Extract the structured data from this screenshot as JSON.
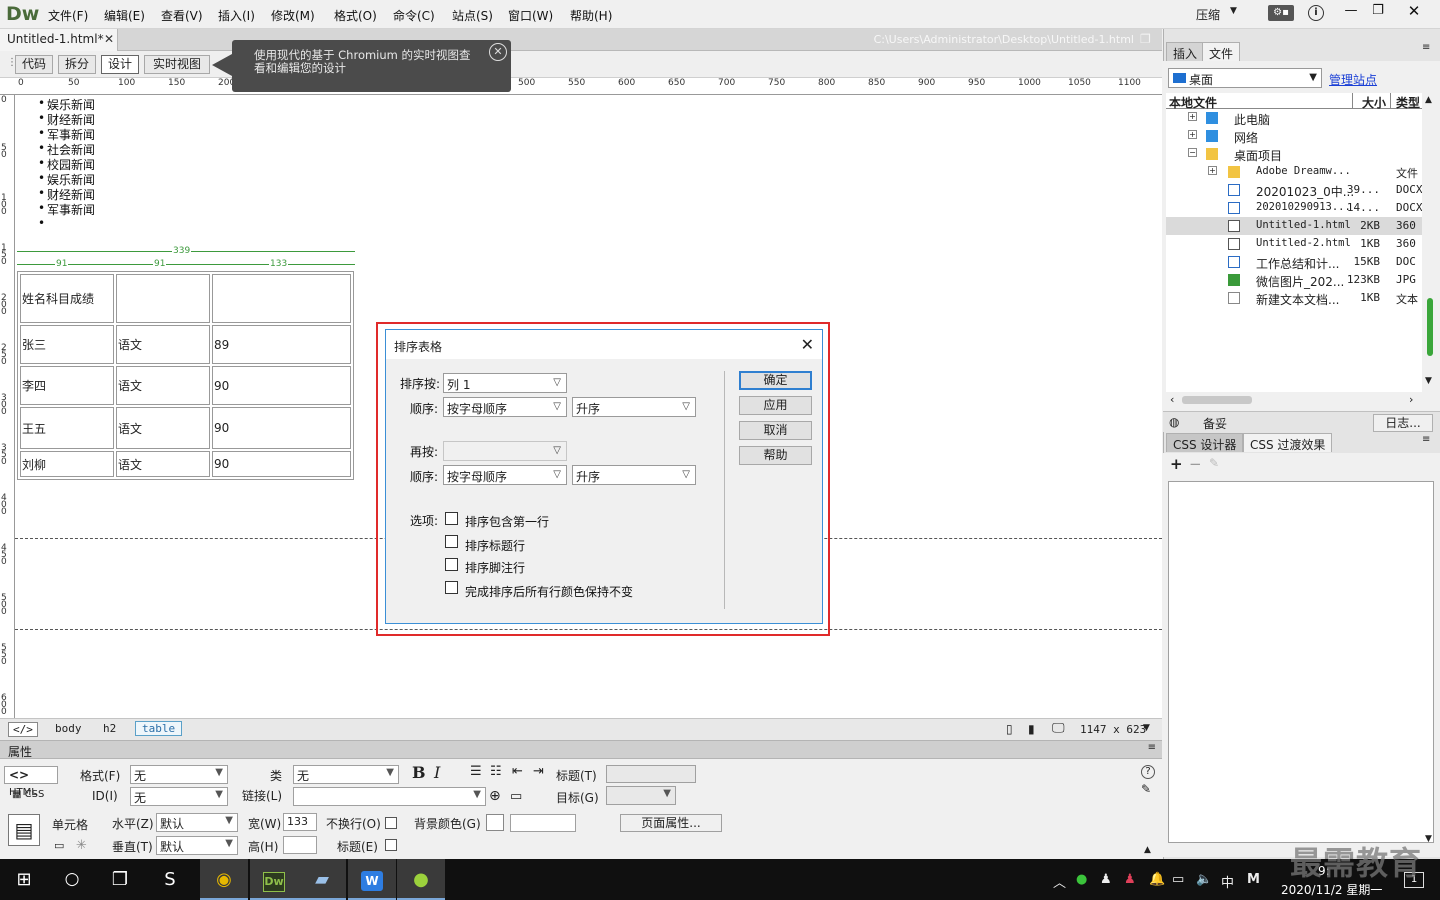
{
  "app": {
    "logo": "Dw",
    "menus": [
      "文件(F)",
      "编辑(E)",
      "查看(V)",
      "插入(I)",
      "修改(M)",
      "格式(O)",
      "命令(C)",
      "站点(S)",
      "窗口(W)",
      "帮助(H)"
    ],
    "workspace": "压缩"
  },
  "document": {
    "tab": "Untitled-1.html*",
    "path": "C:\\Users\\Administrator\\Desktop\\Untitled-1.html"
  },
  "view_buttons": [
    "代码",
    "拆分",
    "设计",
    "实时视图"
  ],
  "tooltip": {
    "line1": "使用现代的基于 Chromium 的实时视图查",
    "line2": "看和编辑您的设计"
  },
  "ruler_top": [
    "0",
    "50",
    "100",
    "150",
    "200",
    "500",
    "550",
    "600",
    "650",
    "700",
    "750",
    "800",
    "850",
    "900",
    "950",
    "1000",
    "1050",
    "1100"
  ],
  "ruler_left": [
    "0",
    "5\n0",
    "1\n0\n0",
    "1\n5\n0",
    "2\n0\n0",
    "2\n5\n0",
    "3\n0\n0",
    "3\n5\n0",
    "4\n0\n0",
    "4\n5\n0",
    "5\n0\n0",
    "5\n5\n0",
    "6\n0\n0"
  ],
  "canvas": {
    "list_items": [
      "娱乐新闻",
      "财经新闻",
      "军事新闻",
      "社会新闻",
      "校园新闻",
      "娱乐新闻",
      "财经新闻",
      "军事新闻",
      ""
    ],
    "table_width": "339",
    "col_widths": [
      "91",
      "91",
      "133"
    ],
    "table_rows": [
      [
        "姓名科目成绩",
        "",
        ""
      ],
      [
        "张三",
        "语文",
        "89"
      ],
      [
        "李四",
        "语文",
        "90"
      ],
      [
        "王五",
        "语文",
        "90"
      ],
      [
        "刘柳",
        "语文",
        "90"
      ]
    ]
  },
  "tagbar": {
    "code_icon": "</>",
    "tags": [
      "body",
      "h2",
      "table"
    ],
    "dims": "1147 x 623"
  },
  "properties": {
    "title": "属性",
    "html_btn": "HTML",
    "css_btn": "CSS",
    "format_label": "格式(F)",
    "format_value": "无",
    "class_label": "类",
    "class_value": "无",
    "id_label": "ID(I)",
    "id_value": "无",
    "link_label": "链接(L)",
    "title_label": "标题(T)",
    "target_label": "目标(G)",
    "cell_label": "单元格",
    "horiz_label": "水平(Z)",
    "horiz_value": "默认",
    "vert_label": "垂直(T)",
    "vert_value": "默认",
    "width_label": "宽(W)",
    "width_value": "133",
    "height_label": "高(H)",
    "nowrap_label": "不换行(O)",
    "header_label": "标题(E)",
    "bg_label": "背景颜色(G)",
    "page_props": "页面属性..."
  },
  "files_panel": {
    "tabs": [
      "插入",
      "文件"
    ],
    "site": "桌面",
    "manage": "管理站点",
    "headers": {
      "name": "本地文件",
      "size": "大小",
      "type": "类型"
    },
    "rows": [
      {
        "name": "此电脑",
        "size": "",
        "type": "",
        "indent": 1,
        "exp": "+",
        "icon": "pc"
      },
      {
        "name": "网络",
        "size": "",
        "type": "",
        "indent": 1,
        "exp": "+",
        "icon": "net"
      },
      {
        "name": "桌面项目",
        "size": "",
        "type": "",
        "indent": 1,
        "exp": "-",
        "icon": "folder"
      },
      {
        "name": "Adobe Dreamw...",
        "size": "",
        "type": "文件",
        "indent": 2,
        "exp": "+",
        "icon": "folder"
      },
      {
        "name": "20201023_0中...",
        "size": "39...",
        "type": "DOCX",
        "indent": 2,
        "exp": "",
        "icon": "doc"
      },
      {
        "name": "202010290913...",
        "size": "14...",
        "type": "DOCX",
        "indent": 2,
        "exp": "",
        "icon": "doc"
      },
      {
        "name": "Untitled-1.html",
        "size": "2KB",
        "type": "360",
        "indent": 2,
        "exp": "",
        "icon": "html",
        "selected": true
      },
      {
        "name": "Untitled-2.html",
        "size": "1KB",
        "type": "360",
        "indent": 2,
        "exp": "",
        "icon": "html"
      },
      {
        "name": "工作总结和计...",
        "size": "15KB",
        "type": "DOC",
        "indent": 2,
        "exp": "",
        "icon": "doc"
      },
      {
        "name": "微信图片_202...",
        "size": "123KB",
        "type": "JPG",
        "indent": 2,
        "exp": "",
        "icon": "img"
      },
      {
        "name": "新建文本文档...",
        "size": "1KB",
        "type": "文本",
        "indent": 2,
        "exp": "",
        "icon": "txt"
      }
    ],
    "status": "备妥",
    "log": "日志..."
  },
  "css_panel": {
    "tabs": [
      "CSS 设计器",
      "CSS 过渡效果"
    ]
  },
  "dialog": {
    "title": "排序表格",
    "sort_by_label": "排序按:",
    "sort_by_value": "列 1",
    "order_label": "顺序:",
    "order1_value": "按字母顺序",
    "dir1_value": "升序",
    "then_label": "再按:",
    "then_value": "",
    "order2_label": "顺序:",
    "order2_value": "按字母顺序",
    "dir2_value": "升序",
    "options_label": "选项:",
    "options": [
      "排序包含第一行",
      "排序标题行",
      "排序脚注行",
      "完成排序后所有行颜色保持不变"
    ],
    "buttons": [
      "确定",
      "应用",
      "取消",
      "帮助"
    ]
  },
  "taskbar": {
    "ime": "中",
    "ime2": "M",
    "date": "2020/11/2 星期一",
    "time": "9:",
    "notif": "1"
  },
  "watermark": "最需教育",
  "colors": {
    "highlight": "#e02a2a",
    "dialog_border": "#3b8fd6",
    "guide_green": "#3d9a3d",
    "link": "#1a3fd6"
  }
}
